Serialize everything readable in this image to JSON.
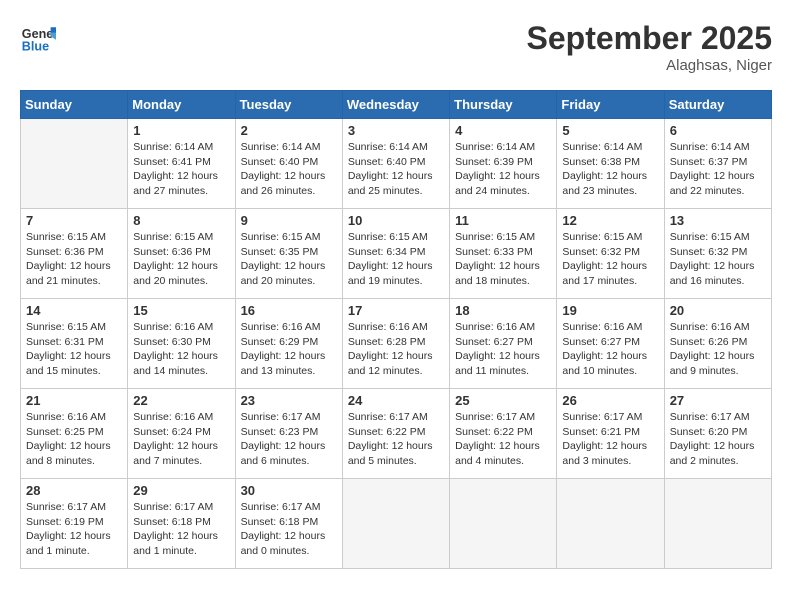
{
  "header": {
    "logo_line1": "General",
    "logo_line2": "Blue",
    "month_title": "September 2025",
    "location": "Alaghsas, Niger"
  },
  "days_of_week": [
    "Sunday",
    "Monday",
    "Tuesday",
    "Wednesday",
    "Thursday",
    "Friday",
    "Saturday"
  ],
  "weeks": [
    [
      {
        "day": "",
        "sunrise": "",
        "sunset": "",
        "daylight": ""
      },
      {
        "day": "1",
        "sunrise": "6:14 AM",
        "sunset": "6:41 PM",
        "daylight": "12 hours and 27 minutes."
      },
      {
        "day": "2",
        "sunrise": "6:14 AM",
        "sunset": "6:40 PM",
        "daylight": "12 hours and 26 minutes."
      },
      {
        "day": "3",
        "sunrise": "6:14 AM",
        "sunset": "6:40 PM",
        "daylight": "12 hours and 25 minutes."
      },
      {
        "day": "4",
        "sunrise": "6:14 AM",
        "sunset": "6:39 PM",
        "daylight": "12 hours and 24 minutes."
      },
      {
        "day": "5",
        "sunrise": "6:14 AM",
        "sunset": "6:38 PM",
        "daylight": "12 hours and 23 minutes."
      },
      {
        "day": "6",
        "sunrise": "6:14 AM",
        "sunset": "6:37 PM",
        "daylight": "12 hours and 22 minutes."
      }
    ],
    [
      {
        "day": "7",
        "sunrise": "6:15 AM",
        "sunset": "6:36 PM",
        "daylight": "12 hours and 21 minutes."
      },
      {
        "day": "8",
        "sunrise": "6:15 AM",
        "sunset": "6:36 PM",
        "daylight": "12 hours and 20 minutes."
      },
      {
        "day": "9",
        "sunrise": "6:15 AM",
        "sunset": "6:35 PM",
        "daylight": "12 hours and 20 minutes."
      },
      {
        "day": "10",
        "sunrise": "6:15 AM",
        "sunset": "6:34 PM",
        "daylight": "12 hours and 19 minutes."
      },
      {
        "day": "11",
        "sunrise": "6:15 AM",
        "sunset": "6:33 PM",
        "daylight": "12 hours and 18 minutes."
      },
      {
        "day": "12",
        "sunrise": "6:15 AM",
        "sunset": "6:32 PM",
        "daylight": "12 hours and 17 minutes."
      },
      {
        "day": "13",
        "sunrise": "6:15 AM",
        "sunset": "6:32 PM",
        "daylight": "12 hours and 16 minutes."
      }
    ],
    [
      {
        "day": "14",
        "sunrise": "6:15 AM",
        "sunset": "6:31 PM",
        "daylight": "12 hours and 15 minutes."
      },
      {
        "day": "15",
        "sunrise": "6:16 AM",
        "sunset": "6:30 PM",
        "daylight": "12 hours and 14 minutes."
      },
      {
        "day": "16",
        "sunrise": "6:16 AM",
        "sunset": "6:29 PM",
        "daylight": "12 hours and 13 minutes."
      },
      {
        "day": "17",
        "sunrise": "6:16 AM",
        "sunset": "6:28 PM",
        "daylight": "12 hours and 12 minutes."
      },
      {
        "day": "18",
        "sunrise": "6:16 AM",
        "sunset": "6:27 PM",
        "daylight": "12 hours and 11 minutes."
      },
      {
        "day": "19",
        "sunrise": "6:16 AM",
        "sunset": "6:27 PM",
        "daylight": "12 hours and 10 minutes."
      },
      {
        "day": "20",
        "sunrise": "6:16 AM",
        "sunset": "6:26 PM",
        "daylight": "12 hours and 9 minutes."
      }
    ],
    [
      {
        "day": "21",
        "sunrise": "6:16 AM",
        "sunset": "6:25 PM",
        "daylight": "12 hours and 8 minutes."
      },
      {
        "day": "22",
        "sunrise": "6:16 AM",
        "sunset": "6:24 PM",
        "daylight": "12 hours and 7 minutes."
      },
      {
        "day": "23",
        "sunrise": "6:17 AM",
        "sunset": "6:23 PM",
        "daylight": "12 hours and 6 minutes."
      },
      {
        "day": "24",
        "sunrise": "6:17 AM",
        "sunset": "6:22 PM",
        "daylight": "12 hours and 5 minutes."
      },
      {
        "day": "25",
        "sunrise": "6:17 AM",
        "sunset": "6:22 PM",
        "daylight": "12 hours and 4 minutes."
      },
      {
        "day": "26",
        "sunrise": "6:17 AM",
        "sunset": "6:21 PM",
        "daylight": "12 hours and 3 minutes."
      },
      {
        "day": "27",
        "sunrise": "6:17 AM",
        "sunset": "6:20 PM",
        "daylight": "12 hours and 2 minutes."
      }
    ],
    [
      {
        "day": "28",
        "sunrise": "6:17 AM",
        "sunset": "6:19 PM",
        "daylight": "12 hours and 1 minute."
      },
      {
        "day": "29",
        "sunrise": "6:17 AM",
        "sunset": "6:18 PM",
        "daylight": "12 hours and 1 minute."
      },
      {
        "day": "30",
        "sunrise": "6:17 AM",
        "sunset": "6:18 PM",
        "daylight": "12 hours and 0 minutes."
      },
      {
        "day": "",
        "sunrise": "",
        "sunset": "",
        "daylight": ""
      },
      {
        "day": "",
        "sunrise": "",
        "sunset": "",
        "daylight": ""
      },
      {
        "day": "",
        "sunrise": "",
        "sunset": "",
        "daylight": ""
      },
      {
        "day": "",
        "sunrise": "",
        "sunset": "",
        "daylight": ""
      }
    ]
  ],
  "labels": {
    "sunrise_prefix": "Sunrise: ",
    "sunset_prefix": "Sunset: ",
    "daylight_prefix": "Daylight: "
  }
}
